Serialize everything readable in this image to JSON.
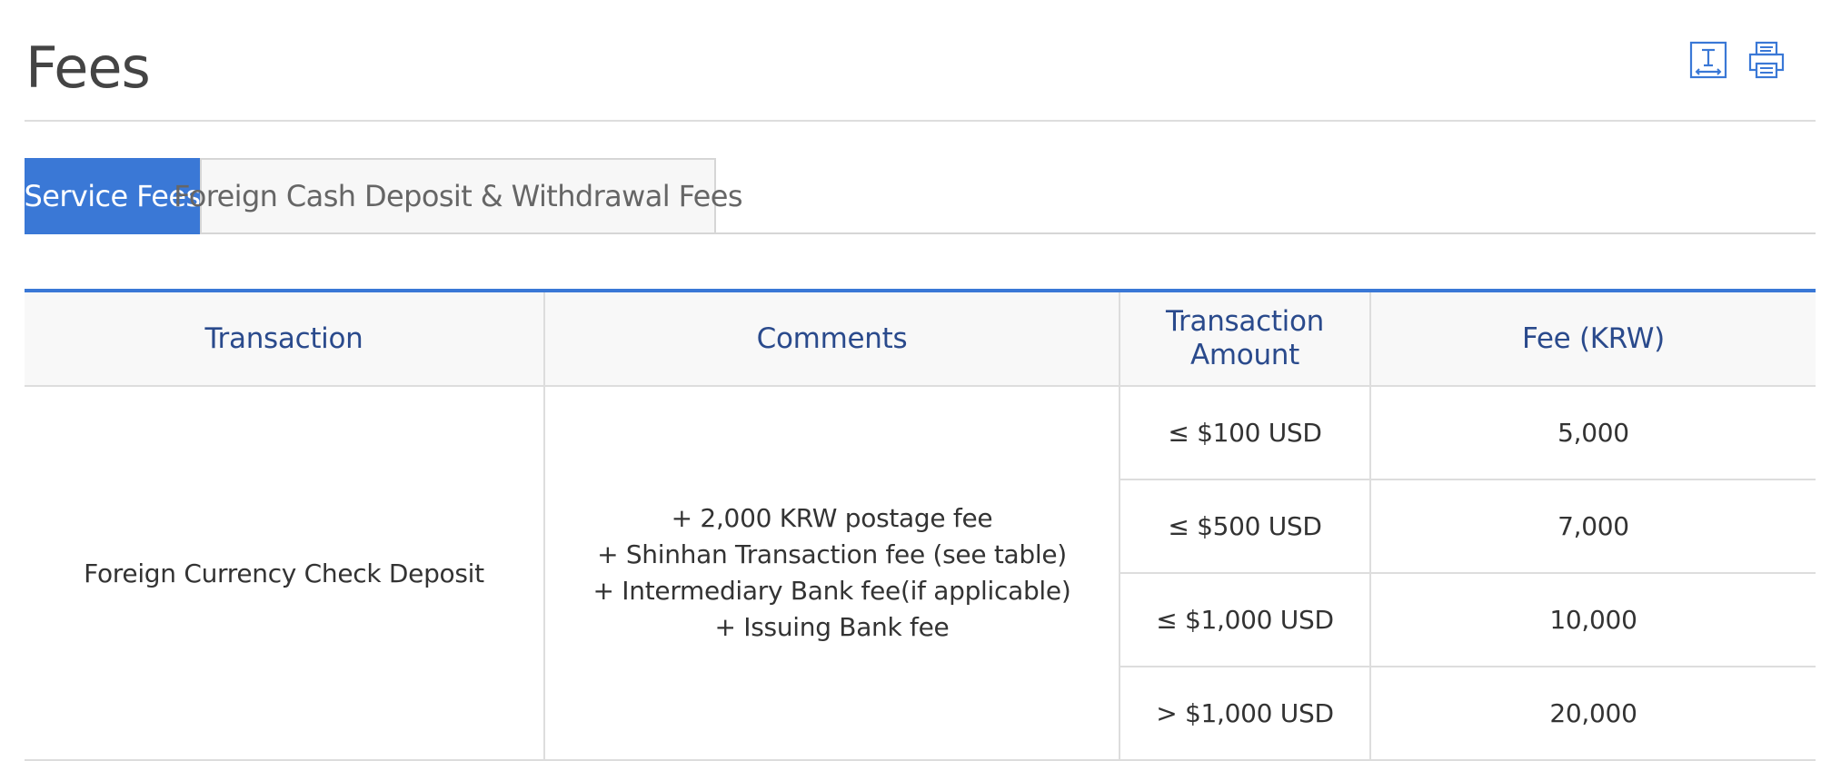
{
  "page": {
    "title": "Fees"
  },
  "toolbar": {
    "text_size_icon": "text-size-icon",
    "print_icon": "print-icon",
    "icon_color": "#3a78d6"
  },
  "tabs": [
    {
      "label": "Service Fees",
      "active": true
    },
    {
      "label": "Foreign Cash Deposit & Withdrawal Fees",
      "active": false
    }
  ],
  "colors": {
    "accent": "#3a78d6",
    "header_text": "#2a4a8c"
  },
  "table": {
    "headers": {
      "transaction": "Transaction",
      "comments": "Comments",
      "amount_line1": "Transaction",
      "amount_line2": "Amount",
      "fee": "Fee (KRW)"
    },
    "rows": [
      {
        "transaction": "Foreign Currency Check Deposit",
        "comments": [
          "+ 2,000 KRW postage fee",
          "+ Shinhan Transaction fee (see table)",
          "+ Intermediary Bank fee(if applicable)",
          "+ Issuing Bank fee"
        ],
        "tiers": [
          {
            "amount": "≤ $100 USD",
            "fee": "5,000"
          },
          {
            "amount": "≤ $500 USD",
            "fee": "7,000"
          },
          {
            "amount": "≤ $1,000 USD",
            "fee": "10,000"
          },
          {
            "amount": "> $1,000 USD",
            "fee": "20,000"
          }
        ]
      }
    ]
  }
}
